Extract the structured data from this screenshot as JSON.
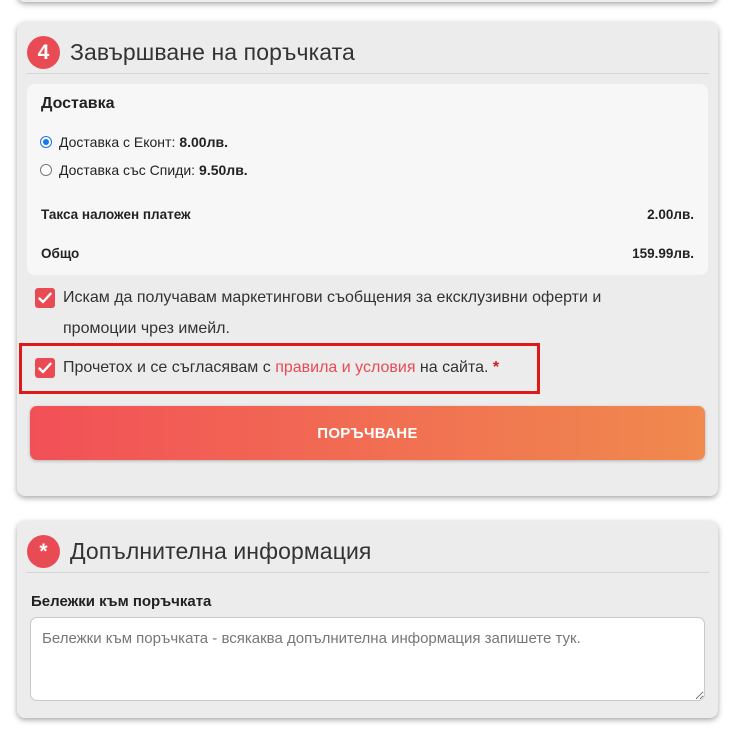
{
  "checkout": {
    "step_number": "4",
    "title": "Завършване на поръчката",
    "shipping": {
      "heading": "Доставка",
      "options": [
        {
          "label": "Доставка с Еконт:",
          "price": "8.00лв.",
          "selected": true
        },
        {
          "label": "Доставка със Спиди:",
          "price": "9.50лв.",
          "selected": false
        }
      ],
      "cod_fee_label": "Такса наложен платеж",
      "cod_fee_value": "2.00лв.",
      "total_label": "Общо",
      "total_value": "159.99лв."
    },
    "marketing_consent": {
      "checked": true,
      "text": "Искам да получавам маркетингови съобщения за ексклузивни оферти и промоции чрез имейл."
    },
    "terms": {
      "checked": true,
      "prefix": "Прочетох и се съгласявам с ",
      "link_text": "правила и условия",
      "suffix": " на сайта. ",
      "required_mark": "*"
    },
    "submit_label": "ПОРЪЧВАНЕ"
  },
  "additional_info": {
    "badge": "*",
    "title": "Допълнителна информация",
    "notes_label": "Бележки към поръчката",
    "notes_placeholder": "Бележки към поръчката - всякаква допълнителна информация запишете тук.",
    "notes_value": ""
  },
  "colors": {
    "accent": "#e94b54",
    "button_gradient_start": "#f25057",
    "button_gradient_end": "#f08a4e",
    "highlight_border": "#e01818",
    "card_background": "#ececec",
    "radio_selected": "#1a73e8"
  },
  "icons": {
    "checkbox_mark": "checkmark-icon"
  }
}
